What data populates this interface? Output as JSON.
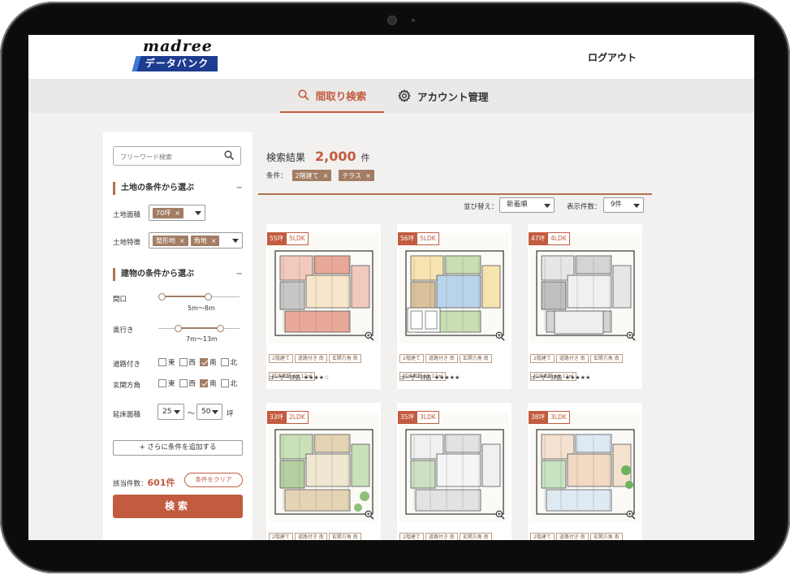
{
  "header": {
    "logo_text": "madree",
    "logo_sub": "データバンク",
    "logout": "ログアウト"
  },
  "nav": {
    "tabs": [
      {
        "label": "間取り検索",
        "icon": "search-icon",
        "active": true
      },
      {
        "label": "アカウント管理",
        "icon": "gear-icon",
        "active": false
      }
    ]
  },
  "sidebar": {
    "search_placeholder": "フリーワード検索",
    "land_section": "土地の条件から選ぶ",
    "land_area_label": "土地面積",
    "land_area_chip": "70坪",
    "land_feature_label": "土地特徴",
    "land_feature_chips": [
      "整形地",
      "角地"
    ],
    "building_section": "建物の条件から選ぶ",
    "frontage_label": "間口",
    "frontage_value": "5m〜8m",
    "depth_label": "奥行き",
    "depth_value": "7m〜13m",
    "road_label": "道路付き",
    "entrance_label": "玄関方角",
    "directions": [
      "東",
      "西",
      "南",
      "北"
    ],
    "road_checked": [
      false,
      false,
      true,
      false
    ],
    "entrance_checked": [
      false,
      false,
      true,
      false
    ],
    "floor_area_label": "延床面積",
    "floor_min": "25",
    "floor_max": "50",
    "floor_tilde": "〜",
    "floor_unit": "坪",
    "add_condition": "+ さらに条件を追加する",
    "count_prefix": "該当件数：",
    "count_value": "601件",
    "clear_button": "条件をクリア",
    "search_button": "検索",
    "section_toggle": "−"
  },
  "results": {
    "title": "検索結果",
    "count": "2,000",
    "count_unit": "件",
    "cond_label": "条件：",
    "cond_chips": [
      "2階建て",
      "テラス"
    ],
    "sort_label": "並び替え：",
    "sort_value": "新着順",
    "per_page_label": "表示件数：",
    "per_page_value": "9件"
  },
  "cards": [
    {
      "tsubo": "55坪",
      "layout": "5LDK",
      "tags": [
        "2階建て",
        "道路付き 南",
        "玄関方角 南",
        "延床面積 69.12㎡"
      ],
      "rating_label": "ユーザー評価",
      "stars": "★★★★☆"
    },
    {
      "tsubo": "56坪",
      "layout": "5LDK",
      "tags": [
        "2階建て",
        "道路付き 南",
        "玄関方角 南",
        "延床面積 69.12㎡"
      ],
      "rating_label": "ユーザー評価",
      "stars": "★★★★★"
    },
    {
      "tsubo": "47坪",
      "layout": "4LDK",
      "tags": [
        "2階建て",
        "道路付き 南",
        "玄関方角 南",
        "延床面積 69.12㎡"
      ],
      "rating_label": "ユーザー評価",
      "stars": "★★★★★"
    },
    {
      "tsubo": "33坪",
      "layout": "2LDK",
      "tags": [
        "2階建て",
        "道路付き 南",
        "玄関方角 南"
      ],
      "rating_label": "",
      "stars": ""
    },
    {
      "tsubo": "35坪",
      "layout": "3LDK",
      "tags": [
        "2階建て",
        "道路付き 南",
        "玄関方角 南"
      ],
      "rating_label": "",
      "stars": ""
    },
    {
      "tsubo": "38坪",
      "layout": "3LDK",
      "tags": [
        "2階建て",
        "道路付き 南",
        "玄関方角 南"
      ],
      "rating_label": "",
      "stars": ""
    }
  ],
  "colors": {
    "accent": "#c25b3f",
    "chip": "#a27d63",
    "logo_band": "#1d3b8f"
  }
}
